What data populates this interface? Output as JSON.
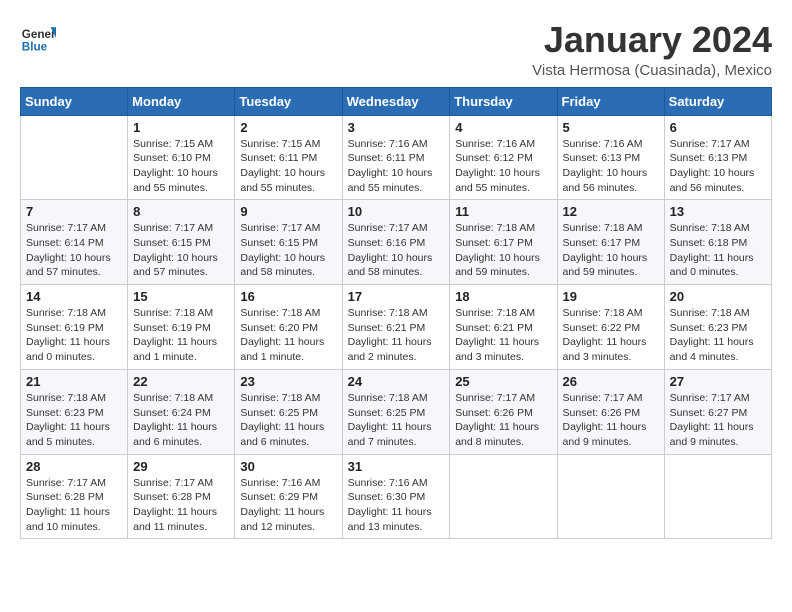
{
  "app": {
    "logo_general": "General",
    "logo_blue": "Blue"
  },
  "header": {
    "title": "January 2024",
    "location": "Vista Hermosa (Cuasinada), Mexico"
  },
  "calendar": {
    "days_of_week": [
      "Sunday",
      "Monday",
      "Tuesday",
      "Wednesday",
      "Thursday",
      "Friday",
      "Saturday"
    ],
    "weeks": [
      [
        {
          "day": "",
          "info": ""
        },
        {
          "day": "1",
          "info": "Sunrise: 7:15 AM\nSunset: 6:10 PM\nDaylight: 10 hours\nand 55 minutes."
        },
        {
          "day": "2",
          "info": "Sunrise: 7:15 AM\nSunset: 6:11 PM\nDaylight: 10 hours\nand 55 minutes."
        },
        {
          "day": "3",
          "info": "Sunrise: 7:16 AM\nSunset: 6:11 PM\nDaylight: 10 hours\nand 55 minutes."
        },
        {
          "day": "4",
          "info": "Sunrise: 7:16 AM\nSunset: 6:12 PM\nDaylight: 10 hours\nand 55 minutes."
        },
        {
          "day": "5",
          "info": "Sunrise: 7:16 AM\nSunset: 6:13 PM\nDaylight: 10 hours\nand 56 minutes."
        },
        {
          "day": "6",
          "info": "Sunrise: 7:17 AM\nSunset: 6:13 PM\nDaylight: 10 hours\nand 56 minutes."
        }
      ],
      [
        {
          "day": "7",
          "info": "Sunrise: 7:17 AM\nSunset: 6:14 PM\nDaylight: 10 hours\nand 57 minutes."
        },
        {
          "day": "8",
          "info": "Sunrise: 7:17 AM\nSunset: 6:15 PM\nDaylight: 10 hours\nand 57 minutes."
        },
        {
          "day": "9",
          "info": "Sunrise: 7:17 AM\nSunset: 6:15 PM\nDaylight: 10 hours\nand 58 minutes."
        },
        {
          "day": "10",
          "info": "Sunrise: 7:17 AM\nSunset: 6:16 PM\nDaylight: 10 hours\nand 58 minutes."
        },
        {
          "day": "11",
          "info": "Sunrise: 7:18 AM\nSunset: 6:17 PM\nDaylight: 10 hours\nand 59 minutes."
        },
        {
          "day": "12",
          "info": "Sunrise: 7:18 AM\nSunset: 6:17 PM\nDaylight: 10 hours\nand 59 minutes."
        },
        {
          "day": "13",
          "info": "Sunrise: 7:18 AM\nSunset: 6:18 PM\nDaylight: 11 hours\nand 0 minutes."
        }
      ],
      [
        {
          "day": "14",
          "info": "Sunrise: 7:18 AM\nSunset: 6:19 PM\nDaylight: 11 hours\nand 0 minutes."
        },
        {
          "day": "15",
          "info": "Sunrise: 7:18 AM\nSunset: 6:19 PM\nDaylight: 11 hours\nand 1 minute."
        },
        {
          "day": "16",
          "info": "Sunrise: 7:18 AM\nSunset: 6:20 PM\nDaylight: 11 hours\nand 1 minute."
        },
        {
          "day": "17",
          "info": "Sunrise: 7:18 AM\nSunset: 6:21 PM\nDaylight: 11 hours\nand 2 minutes."
        },
        {
          "day": "18",
          "info": "Sunrise: 7:18 AM\nSunset: 6:21 PM\nDaylight: 11 hours\nand 3 minutes."
        },
        {
          "day": "19",
          "info": "Sunrise: 7:18 AM\nSunset: 6:22 PM\nDaylight: 11 hours\nand 3 minutes."
        },
        {
          "day": "20",
          "info": "Sunrise: 7:18 AM\nSunset: 6:23 PM\nDaylight: 11 hours\nand 4 minutes."
        }
      ],
      [
        {
          "day": "21",
          "info": "Sunrise: 7:18 AM\nSunset: 6:23 PM\nDaylight: 11 hours\nand 5 minutes."
        },
        {
          "day": "22",
          "info": "Sunrise: 7:18 AM\nSunset: 6:24 PM\nDaylight: 11 hours\nand 6 minutes."
        },
        {
          "day": "23",
          "info": "Sunrise: 7:18 AM\nSunset: 6:25 PM\nDaylight: 11 hours\nand 6 minutes."
        },
        {
          "day": "24",
          "info": "Sunrise: 7:18 AM\nSunset: 6:25 PM\nDaylight: 11 hours\nand 7 minutes."
        },
        {
          "day": "25",
          "info": "Sunrise: 7:17 AM\nSunset: 6:26 PM\nDaylight: 11 hours\nand 8 minutes."
        },
        {
          "day": "26",
          "info": "Sunrise: 7:17 AM\nSunset: 6:26 PM\nDaylight: 11 hours\nand 9 minutes."
        },
        {
          "day": "27",
          "info": "Sunrise: 7:17 AM\nSunset: 6:27 PM\nDaylight: 11 hours\nand 9 minutes."
        }
      ],
      [
        {
          "day": "28",
          "info": "Sunrise: 7:17 AM\nSunset: 6:28 PM\nDaylight: 11 hours\nand 10 minutes."
        },
        {
          "day": "29",
          "info": "Sunrise: 7:17 AM\nSunset: 6:28 PM\nDaylight: 11 hours\nand 11 minutes."
        },
        {
          "day": "30",
          "info": "Sunrise: 7:16 AM\nSunset: 6:29 PM\nDaylight: 11 hours\nand 12 minutes."
        },
        {
          "day": "31",
          "info": "Sunrise: 7:16 AM\nSunset: 6:30 PM\nDaylight: 11 hours\nand 13 minutes."
        },
        {
          "day": "",
          "info": ""
        },
        {
          "day": "",
          "info": ""
        },
        {
          "day": "",
          "info": ""
        }
      ]
    ]
  }
}
